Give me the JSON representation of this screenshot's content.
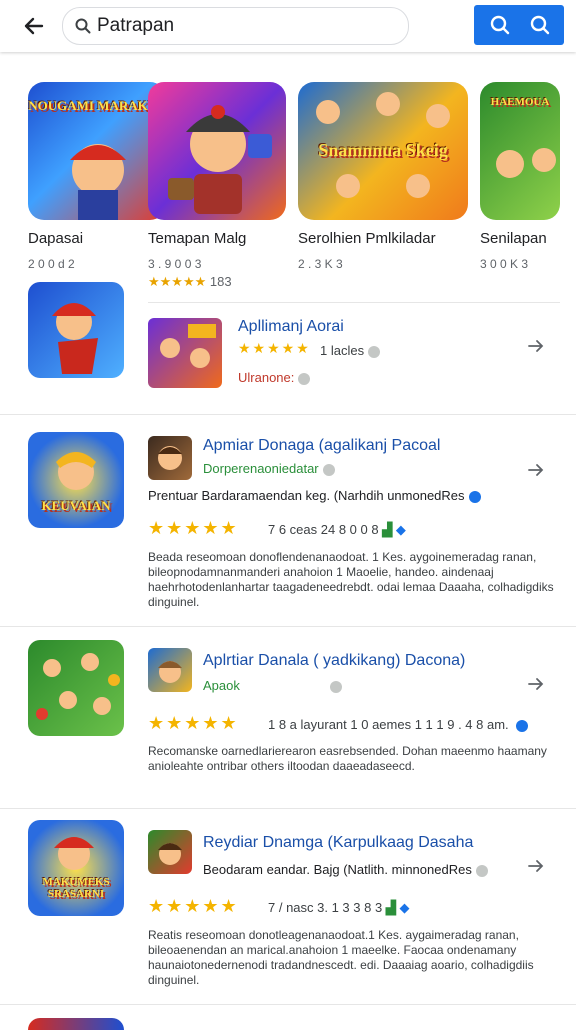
{
  "search": {
    "query": "Patrapan"
  },
  "featured": [
    {
      "title": "Dapasai",
      "size": "2 0 0 d 2",
      "banner": "NOUGAMI MARAKUL",
      "colors": [
        "#1e4fd0",
        "#e23b2e"
      ]
    },
    {
      "title": "Temapan Malg",
      "size": "3 . 9 0 0 3",
      "rating": "★★★★★",
      "rating_count": "183",
      "banner": "",
      "colors": [
        "#6b2fd6",
        "#f06a1b"
      ]
    },
    {
      "title": "Serolhien Pmlkiladar",
      "size": "2 . 3 K 3",
      "banner": "Snamnnua Skeig",
      "colors": [
        "#1d6bd1",
        "#f3b51f"
      ]
    },
    {
      "title": "Senilapan",
      "size": "3 0 0 K 3",
      "banner": "HAEMOUA",
      "colors": [
        "#2c8a2c",
        "#8fd14a"
      ]
    }
  ],
  "row0": {
    "name": "Apllimanj Aorai",
    "rating": "1 lacles",
    "meta": "Ulranone:"
  },
  "rows": [
    {
      "name": "Apmiar Donaga (agalikanj Pacoal",
      "dev": "Dorperenaoniedatar",
      "publisher": "Prentuar Bardaramaendan keg. (Narhdih unmonedRes",
      "rating_text": "7 6 ceas 24 8 0 0 8",
      "desc": "Beada reseomoan donoflendenanaodoat. 1 Kes. aygoinemeradag ranan, bileopnodamnanmanderi anahoion 1 Maoelie, handeo. aindenaaj haehrhotodenlanhartar taagadeneedrebdt. odai lemaa Daaaha, colhadigdiks dinguinel.",
      "more": "dinguinel.",
      "banner": "KEUVAIAN"
    },
    {
      "name": "Aplrtiar Danala ( yadkikang) Dacona)",
      "dev": "Apaok",
      "publisher": "",
      "rating_text": "1 8 a layurant 1 0 aemes 1 1 1 9 . 4 8 am.",
      "desc": "Recomanske oarnedlarierearon easrebsended. Dohan maeenmo haamany anioleahte ontribar others iltoodan daaeadaseecd.",
      "more": "",
      "banner": ""
    },
    {
      "name": "Reydiar Dnamga (Karpulkaag Dasaha",
      "dev": "",
      "publisher": "Beodaram eandar. Bajg (Natlith. minnonedRes",
      "rating_text": "7 / nasc 3. 1 3 3 8 3",
      "desc": "Reatis reseomoan donotleagenanaodoat.1 Kes. aygaimeradag ranan, bileoaenendan an marical.anahoion 1 maeelke. Faocaa ondenamany haunaiotonedernenodi tradandnescedt. edi. Daaaiag aoario, colhadigdiis dinguinel.",
      "more": "dinguinel.",
      "banner": "MAKUMEKS SRASARNI"
    }
  ],
  "colors": {
    "accent": "#1a73e8",
    "star": "#f4b400",
    "link": "#1a4fa8",
    "dev": "#2a8f3a"
  }
}
